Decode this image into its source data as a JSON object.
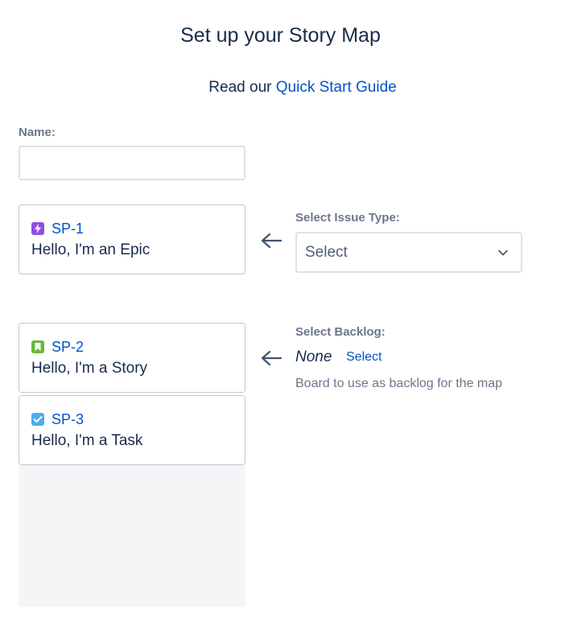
{
  "header": {
    "title": "Set up your Story Map",
    "guide_prefix": "Read our ",
    "guide_link": "Quick Start Guide"
  },
  "name_field": {
    "label": "Name:",
    "value": "",
    "placeholder": ""
  },
  "epic_card": {
    "key": "SP-1",
    "summary": "Hello, I'm an Epic",
    "icon": "epic-icon"
  },
  "backlog_cards": [
    {
      "key": "SP-2",
      "summary": "Hello, I'm a Story",
      "icon": "story-icon"
    },
    {
      "key": "SP-3",
      "summary": "Hello, I'm a Task",
      "icon": "task-icon"
    }
  ],
  "issue_type": {
    "label": "Select Issue Type:",
    "selected": "Select"
  },
  "backlog": {
    "label": "Select Backlog:",
    "value": "None",
    "action": "Select",
    "help": "Board to use as backlog for the map"
  },
  "colors": {
    "link": "#0052cc",
    "epic": "#904ee2",
    "story": "#63ba3c",
    "task": "#4bade8",
    "text": "#172b4d",
    "muted": "#6b778c"
  }
}
